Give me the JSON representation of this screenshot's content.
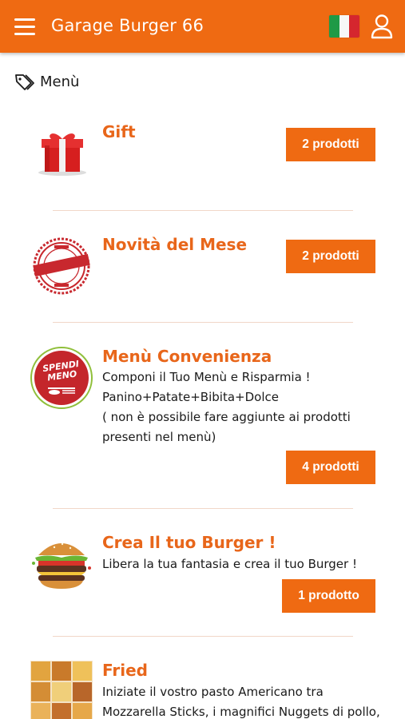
{
  "appbar": {
    "title": "Garage Burger 66",
    "menu_icon": "hamburger-menu-icon",
    "language_icon": "italian-flag-icon",
    "account_icon": "user-icon",
    "color": "#ef6a12"
  },
  "section": {
    "label": "Menù",
    "icon": "tag-icon"
  },
  "categories": [
    {
      "title": "Gift",
      "button": "2 prodotti",
      "thumb": "gift-box"
    },
    {
      "title": "Novità del Mese",
      "button": "2 prodotti",
      "thumb": "limited-edition-stamp"
    },
    {
      "title": "Menù Convenienza",
      "desc": [
        "Componi il Tuo Menù e Risparmia !",
        "Panino+Patate+Bibita+Dolce",
        "( non è possibile fare aggiunte ai prodotti",
        "presenti nel menù)"
      ],
      "button": "4 prodotti",
      "thumb": "spendi-meno-badge",
      "badge_text": [
        "SPENDI",
        "MENO"
      ]
    },
    {
      "title": "Crea Il tuo Burger !",
      "desc": [
        "Libera la tua fantasia e crea il tuo Burger !"
      ],
      "button": "1 prodotto",
      "thumb": "burger"
    },
    {
      "title": "Fried",
      "desc": [
        "Iniziate il vostro pasto Americano tra",
        "Mozzarella Sticks, i magnifici Nuggets di pollo,"
      ],
      "thumb": "fried-food-collage"
    }
  ],
  "colors": {
    "accent": "#ef6a12",
    "title": "#e8661a",
    "divider": "#f1d7c8"
  }
}
